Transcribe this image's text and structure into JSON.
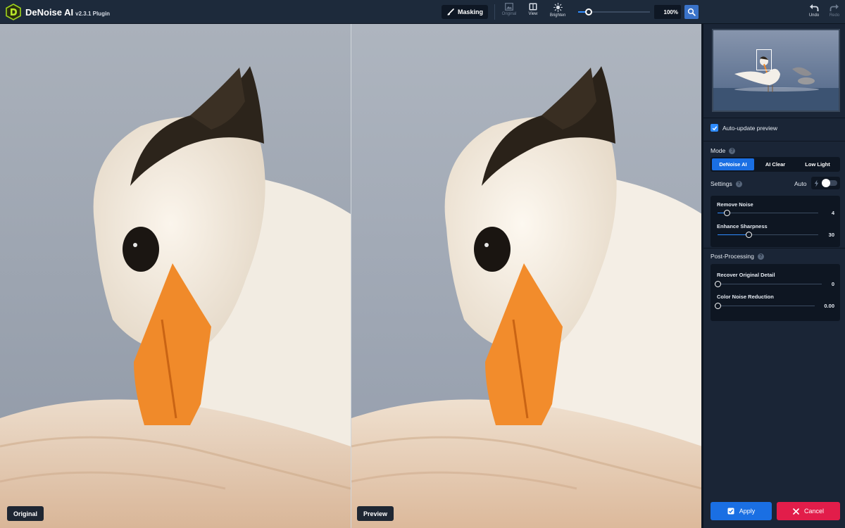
{
  "app": {
    "name": "DeNoise AI",
    "version": "v2.3.1 Plugin"
  },
  "toolbar": {
    "masking_label": "Masking",
    "original_label": "Original",
    "view_label": "View",
    "brighten_label": "Brighten",
    "zoom_value": "100%",
    "zoom_level_fraction": 0.15,
    "undo_label": "Undo",
    "redo_label": "Redo"
  },
  "canvas": {
    "left_label": "Original",
    "right_label": "Preview"
  },
  "panel": {
    "auto_update_label": "Auto-update preview",
    "auto_update_checked": true,
    "mode_title": "Mode",
    "modes": [
      {
        "label": "DeNoise AI",
        "active": true
      },
      {
        "label": "AI Clear",
        "active": false
      },
      {
        "label": "Low Light",
        "active": false
      }
    ],
    "settings_title": "Settings",
    "auto_label": "Auto",
    "settings": [
      {
        "label": "Remove Noise",
        "value": "4",
        "fraction": 0.09
      },
      {
        "label": "Enhance Sharpness",
        "value": "30",
        "fraction": 0.31
      }
    ],
    "post_processing_title": "Post-Processing",
    "post_processing": [
      {
        "label": "Recover Original Detail",
        "value": "0",
        "fraction": 0.0
      },
      {
        "label": "Color Noise Reduction",
        "value": "0.00",
        "fraction": 0.0
      }
    ],
    "apply_label": "Apply",
    "cancel_label": "Cancel"
  },
  "colors": {
    "accent": "#1a6fe3",
    "cancel": "#e21d4a",
    "panel_bg": "#1a2536",
    "beak": "#f08a2a"
  }
}
